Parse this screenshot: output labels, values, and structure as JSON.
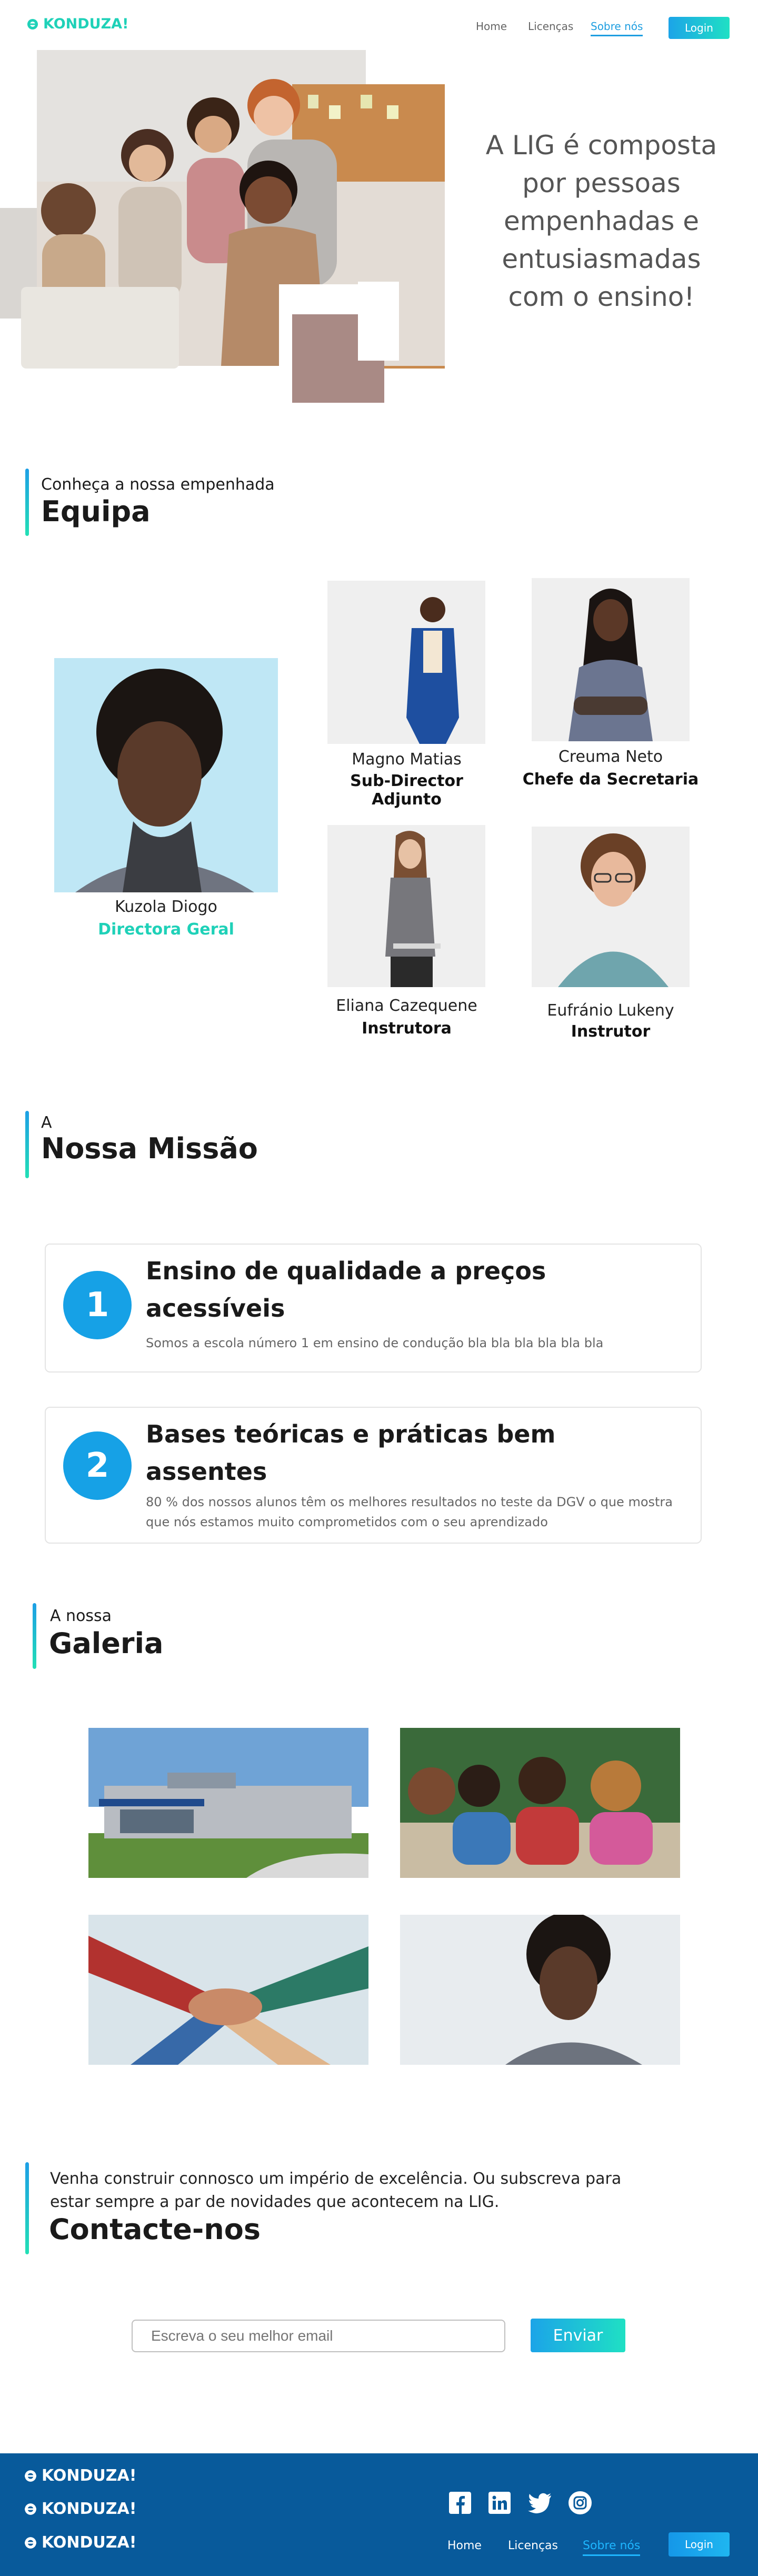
{
  "brand": {
    "name": "KONDUZA!",
    "accent": "#1fd1b8",
    "blue": "#1e9ee0",
    "footer_bg": "#085a9b"
  },
  "nav": {
    "home": "Home",
    "licencas": "Licenças",
    "sobre": "Sobre nós",
    "login": "Login"
  },
  "hero": {
    "line1": "A LIG é composta",
    "line2": "por pessoas",
    "line3": "empenhadas e",
    "line4": "entusiasmadas",
    "line5": "com o ensino!"
  },
  "equipa": {
    "sub": "Conheça a nossa empenhada",
    "title": "Equipa",
    "members": [
      {
        "name": "Kuzola Diogo",
        "role": "Directora Geral"
      },
      {
        "name": "Magno Matias",
        "role": "Sub-Director Adjunto"
      },
      {
        "name": "Creuma Neto",
        "role": "Chefe da Secretaria"
      },
      {
        "name": "Eliana Cazequene",
        "role": "Instrutora"
      },
      {
        "name": "Eufránio Lukeny",
        "role": "Instrutor"
      }
    ]
  },
  "missao": {
    "sub": "A",
    "title": "Nossa Missão",
    "items": [
      {
        "num": "1",
        "title_l1": "Ensino de qualidade a preços",
        "title_l2": "acessíveis",
        "text_l1": "Somos a escola número 1 em ensino de condução bla bla bla bla bla bla",
        "text_l2": ""
      },
      {
        "num": "2",
        "title_l1": "Bases teóricas e práticas bem",
        "title_l2": "assentes",
        "text_l1": "80 % dos nossos alunos têm os melhores resultados no teste da DGV o que mostra",
        "text_l2": "que nós estamos muito comprometidos com o seu aprendizado"
      }
    ]
  },
  "galeria": {
    "sub": "A nossa",
    "title": "Galeria"
  },
  "contacto": {
    "line1": "Venha construir connosco um império de excelência. Ou subscreva para",
    "line2": "estar sempre a par de novidades que acontecem na LIG.",
    "title": "Contacte-nos",
    "placeholder": "Escreva o seu melhor email",
    "button": "Enviar"
  },
  "footer": {
    "logos": [
      "KONDUZA!",
      "KONDUZA!",
      "KONDUZA!"
    ],
    "social": [
      "facebook-icon",
      "linkedin-icon",
      "twitter-icon",
      "instagram-icon"
    ]
  }
}
